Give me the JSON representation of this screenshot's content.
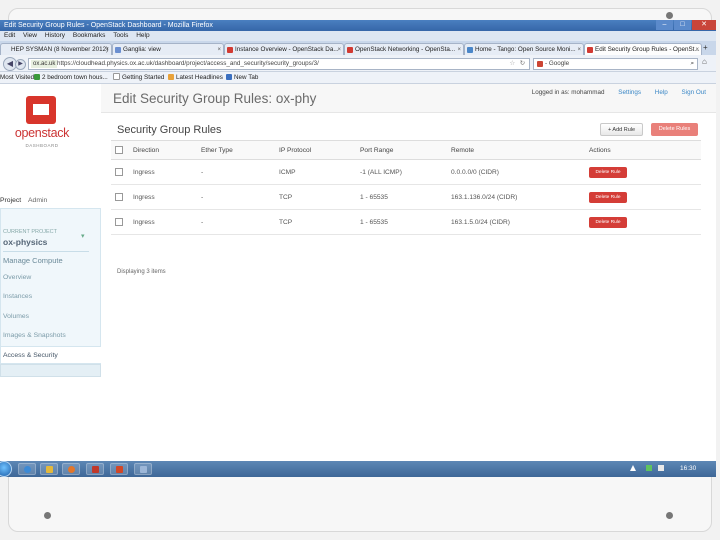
{
  "window": {
    "title": "Edit Security Group Rules - OpenStack Dashboard - Mozilla Firefox",
    "menu": [
      "Edit",
      "View",
      "History",
      "Bookmarks",
      "Tools",
      "Help"
    ]
  },
  "tabs": [
    {
      "label": "HEP SYSMAN (8 November 2012)"
    },
    {
      "label": "Ganglia: view"
    },
    {
      "label": "Instance Overview - OpenStack Da..."
    },
    {
      "label": "OpenStack Networking - OpenSta..."
    },
    {
      "label": "Home - Tango: Open Source Moni..."
    },
    {
      "label": "Edit Security Group Rules - OpenSt..."
    }
  ],
  "navbar": {
    "site_badge": "ox.ac.uk",
    "url": "https://cloudhead.physics.ox.ac.uk/dashboard/project/access_and_security/security_groups/3/",
    "search_value": "- Google"
  },
  "bookmarks": [
    "Most Visited",
    "2 bedroom town hous...",
    "Getting Started",
    "Latest Headlines",
    "New Tab"
  ],
  "sidebar": {
    "logo_text": "openstack",
    "logo_sub": "DASHBOARD",
    "tabs": [
      "Project",
      "Admin"
    ],
    "project_caption": "CURRENT PROJECT",
    "project_name": "ox-physics",
    "section": "Manage Compute",
    "items": [
      "Overview",
      "Instances",
      "Volumes",
      "Images & Snapshots",
      "Access & Security"
    ]
  },
  "header": {
    "title": "Edit Security Group Rules: ox-phy",
    "logged_in": "Logged in as: mohammad",
    "settings": "Settings",
    "help": "Help",
    "signout": "Sign Out"
  },
  "table": {
    "title": "Security Group Rules",
    "add_label": "+ Add Rule",
    "delete_label": "Delete Rules",
    "columns": [
      "Direction",
      "Ether Type",
      "IP Protocol",
      "Port Range",
      "Remote",
      "Actions"
    ],
    "rows": [
      {
        "direction": "Ingress",
        "ether": "-",
        "protocol": "ICMP",
        "port": "-1 (ALL ICMP)",
        "remote": "0.0.0.0/0 (CIDR)",
        "action": "Delete Rule"
      },
      {
        "direction": "Ingress",
        "ether": "-",
        "protocol": "TCP",
        "port": "1 - 65535",
        "remote": "163.1.136.0/24 (CIDR)",
        "action": "Delete Rule"
      },
      {
        "direction": "Ingress",
        "ether": "-",
        "protocol": "TCP",
        "port": "1 - 65535",
        "remote": "163.1.5.0/24 (CIDR)",
        "action": "Delete Rule"
      }
    ],
    "footer": "Displaying 3 items"
  },
  "taskbar": {
    "clock": "16:30"
  },
  "colors": {
    "openstack_red": "#d8352b",
    "danger_button": "#d43d37",
    "link_blue": "#3a87c6",
    "taskbar_blue": "#4a74a5"
  }
}
